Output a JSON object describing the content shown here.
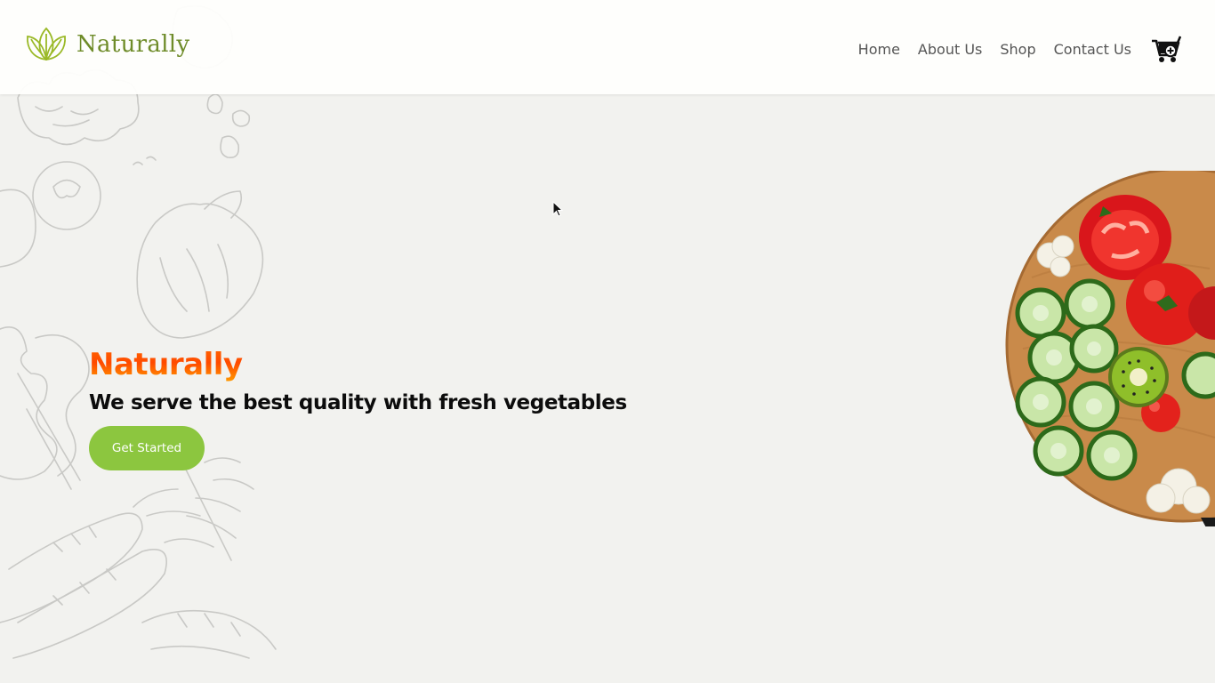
{
  "brand": {
    "logo_text": "Naturally",
    "logo_icon": "leaf-logo-icon",
    "accent": "#8cc63f",
    "logo_color": "#6f8c2a"
  },
  "nav": {
    "items": [
      {
        "label": "Home"
      },
      {
        "label": "About Us"
      },
      {
        "label": "Shop"
      },
      {
        "label": "Contact Us"
      }
    ],
    "cart_icon": "cart-plus-icon"
  },
  "hero": {
    "title": "Naturally",
    "tagline": "We serve the best quality with fresh vegetables",
    "cta_label": "Get Started",
    "title_gradient": [
      "#ff4a00",
      "#ffa500"
    ]
  },
  "background": {
    "page_color": "#f2f2ef",
    "sketch_color": "#c9c9c6"
  }
}
